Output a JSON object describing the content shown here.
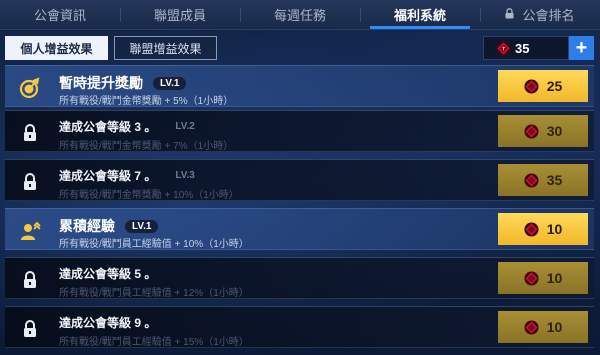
{
  "tabs": [
    {
      "label": "公會資訊",
      "active": false,
      "locked": false
    },
    {
      "label": "聯盟成員",
      "active": false,
      "locked": false
    },
    {
      "label": "每週任務",
      "active": false,
      "locked": false
    },
    {
      "label": "福利系統",
      "active": true,
      "locked": false
    },
    {
      "label": "公會排名",
      "active": false,
      "locked": true
    }
  ],
  "subtabs": {
    "personal": "個人增益效果",
    "alliance": "聯盟增益效果"
  },
  "currency": {
    "amount": "35",
    "add_label": "+"
  },
  "perks": [
    {
      "title": "暫時提升獎勵",
      "level": "LV.1",
      "desc": "所有戰役/戰鬥金幣獎勵 + 5%（1小時）",
      "cost": "25",
      "locked": false,
      "icon": "coin-bonus-icon"
    },
    {
      "title": "達成公會等級 3 。",
      "level": "LV.2",
      "desc": "所有戰役/戰鬥金幣獎勵 + 7%（1小時）",
      "cost": "30",
      "locked": true,
      "icon": "lock-icon"
    },
    {
      "title": "達成公會等級 7 。",
      "level": "LV.3",
      "desc": "所有戰役/戰鬥金幣獎勵 + 10%（1小時）",
      "cost": "35",
      "locked": true,
      "icon": "lock-icon"
    },
    {
      "title": "累積經驗",
      "level": "LV.1",
      "desc": "所有戰役/戰鬥員工經驗值 + 10%（1小時）",
      "cost": "10",
      "locked": false,
      "icon": "exp-bonus-icon"
    },
    {
      "title": "達成公會等級 5 。",
      "level": "",
      "desc": "所有戰役/戰鬥員工經驗值 + 12%（1小時）",
      "cost": "10",
      "locked": true,
      "icon": "lock-icon"
    },
    {
      "title": "達成公會等級 9 。",
      "level": "",
      "desc": "所有戰役/戰鬥員工經驗值 + 15%（1小時）",
      "cost": "10",
      "locked": true,
      "icon": "lock-icon"
    }
  ],
  "colors": {
    "accent": "#2e8cff",
    "button_gold": "#f8c842",
    "gem_red": "#c8102e"
  }
}
